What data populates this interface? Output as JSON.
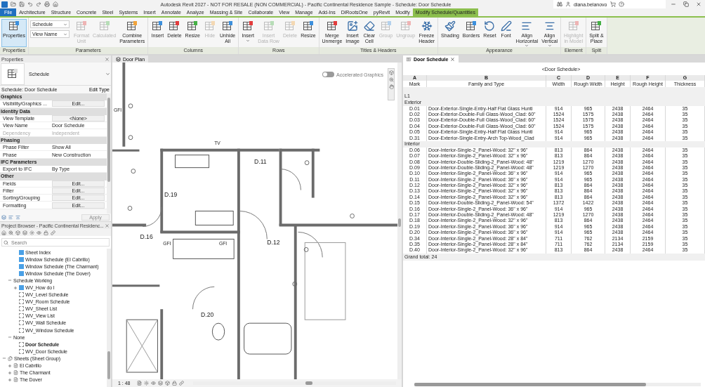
{
  "title_bar": {
    "title": "Autodesk Revit 2027 - NOT FOR RESALE (NON COMMERCIAL) - Pacific Continental Residence Sample - Schedule: Door Schedule",
    "user": "diana.belanovo"
  },
  "menu_tabs": [
    {
      "label": "File",
      "kind": "file",
      "selected": false
    },
    {
      "label": "Architecture",
      "kind": "tab",
      "selected": false
    },
    {
      "label": "Structure",
      "kind": "tab",
      "selected": false
    },
    {
      "label": "Concrete",
      "kind": "tab",
      "selected": false
    },
    {
      "label": "Steel",
      "kind": "tab",
      "selected": false
    },
    {
      "label": "Systems",
      "kind": "tab",
      "selected": false
    },
    {
      "label": "Insert",
      "kind": "tab",
      "selected": false
    },
    {
      "label": "Annotate",
      "kind": "tab",
      "selected": false
    },
    {
      "label": "Analyze",
      "kind": "tab",
      "selected": false
    },
    {
      "label": "Massing & Site",
      "kind": "tab",
      "selected": false
    },
    {
      "label": "Collaborate",
      "kind": "tab",
      "selected": false
    },
    {
      "label": "View",
      "kind": "tab",
      "selected": false
    },
    {
      "label": "Manage",
      "kind": "tab",
      "selected": false
    },
    {
      "label": "Add-Ins",
      "kind": "tab",
      "selected": false
    },
    {
      "label": "DiRootsOne",
      "kind": "tab",
      "selected": false
    },
    {
      "label": "pyRevit",
      "kind": "tab",
      "selected": false
    },
    {
      "label": "Modify",
      "kind": "tab",
      "selected": false
    },
    {
      "label": "Modify Schedule/Quantities",
      "kind": "context",
      "selected": true
    }
  ],
  "ribbon": [
    {
      "title": "Properties",
      "buttons": [
        {
          "label": "Properties",
          "disabled": false,
          "pressed": true
        }
      ]
    },
    {
      "title": "Parameters",
      "selects": [
        "Schedule",
        "View Name"
      ],
      "buttons": [
        {
          "label": "Format\nUnit",
          "disabled": true
        },
        {
          "label": "Calculated",
          "disabled": true
        },
        {
          "label": "Combine\nParameters",
          "disabled": false
        }
      ]
    },
    {
      "title": "Columns",
      "buttons": [
        {
          "label": "Insert",
          "disabled": false
        },
        {
          "label": "Delete",
          "disabled": false
        },
        {
          "label": "Resize",
          "disabled": false
        },
        {
          "label": "Hide",
          "disabled": true
        },
        {
          "label": "Unhide\nAll",
          "disabled": false
        }
      ]
    },
    {
      "title": "Rows",
      "buttons": [
        {
          "label": "Insert",
          "disabled": false,
          "menu": true
        },
        {
          "label": "Insert\nData Row",
          "disabled": true
        },
        {
          "label": "Delete",
          "disabled": true
        },
        {
          "label": "Resize",
          "disabled": false
        }
      ]
    },
    {
      "title": "Titles & Headers",
      "buttons": [
        {
          "label": "Merge\nUnmerge",
          "disabled": false
        },
        {
          "label": "Insert\nImage",
          "disabled": false
        },
        {
          "label": "Clear\nCell",
          "disabled": false
        },
        {
          "label": "Group",
          "disabled": true
        },
        {
          "label": "Ungroup",
          "disabled": true
        },
        {
          "label": "Freeze\nHeader",
          "disabled": false
        }
      ]
    },
    {
      "title": "Appearance",
      "buttons": [
        {
          "label": "Shading",
          "disabled": false
        },
        {
          "label": "Borders",
          "disabled": false
        },
        {
          "label": "Reset",
          "disabled": false
        },
        {
          "label": "Font",
          "disabled": false
        },
        {
          "label": "Align\nHorizontal",
          "disabled": false,
          "menu": true
        },
        {
          "label": "Align\nVertical",
          "disabled": false,
          "menu": true
        }
      ]
    },
    {
      "title": "Element",
      "buttons": [
        {
          "label": "Highlight\nin Model",
          "disabled": true
        }
      ]
    },
    {
      "title": "Split",
      "buttons": [
        {
          "label": "Split &\nPlace",
          "disabled": false
        }
      ]
    }
  ],
  "properties": {
    "title": "Properties",
    "type_name": "Schedule",
    "selector": "Schedule: Door Schedule",
    "edit_type": "Edit Type",
    "sections": [
      {
        "title": "Graphics",
        "rows": [
          {
            "label": "Visibility/Graphics ...",
            "value": "Edit...",
            "kind": "button",
            "disabled": false
          }
        ]
      },
      {
        "title": "Identity Data",
        "rows": [
          {
            "label": "View Template",
            "value": "<None>",
            "kind": "button",
            "disabled": false
          },
          {
            "label": "View Name",
            "value": "Door Schedule",
            "kind": "text",
            "disabled": false
          },
          {
            "label": "Dependency",
            "value": "Independent",
            "kind": "text",
            "disabled": true
          }
        ]
      },
      {
        "title": "Phasing",
        "rows": [
          {
            "label": "Phase Filter",
            "value": "Show All",
            "kind": "text",
            "disabled": false
          },
          {
            "label": "Phase",
            "value": "New Construction",
            "kind": "text",
            "disabled": false
          }
        ]
      },
      {
        "title": "IFC Parameters",
        "rows": [
          {
            "label": "Export to IFC",
            "value": "By Type",
            "kind": "text",
            "disabled": false
          }
        ]
      },
      {
        "title": "Other",
        "rows": [
          {
            "label": "Fields",
            "value": "Edit...",
            "kind": "button",
            "disabled": false
          },
          {
            "label": "Filter",
            "value": "Edit...",
            "kind": "button",
            "disabled": false
          },
          {
            "label": "Sorting/Grouping",
            "value": "Edit...",
            "kind": "button",
            "disabled": false
          },
          {
            "label": "Formatting",
            "value": "Edit...",
            "kind": "button",
            "disabled": false
          }
        ]
      }
    ],
    "apply": "Apply"
  },
  "project_browser": {
    "title": "Project Browser - Pacific Continental Residenc...",
    "search": {
      "placeholder": "Search"
    },
    "tree": [
      {
        "children": [
          {
            "children": [
              {
                "label": "Sheet Index",
                "kind": "schedule",
                "on_sheet": true,
                "selected": false
              },
              {
                "label": "Window Schedule (El Cabrillo)",
                "kind": "schedule",
                "on_sheet": true,
                "selected": false
              },
              {
                "label": "Window Schedule (The Charmant)",
                "kind": "schedule",
                "on_sheet": true,
                "selected": false
              },
              {
                "label": "Window Schedule (The Dover)",
                "kind": "schedule",
                "on_sheet": true,
                "selected": false
              }
            ]
          },
          {
            "label": "Schedule Working",
            "kind": "folder",
            "expanded": true,
            "children": [
              {
                "label": "WV_How do I",
                "kind": "schedule",
                "on_sheet": true,
                "expanded": false,
                "selected": false
              },
              {
                "label": "WV_Level Schedule",
                "kind": "schedule",
                "on_sheet": false,
                "selected": false
              },
              {
                "label": "WV_Room Schedule",
                "kind": "schedule",
                "on_sheet": false,
                "selected": false
              },
              {
                "label": "WV_Sheet List",
                "kind": "schedule",
                "on_sheet": false,
                "selected": false
              },
              {
                "label": "WV_View List",
                "kind": "schedule",
                "on_sheet": false,
                "selected": false
              },
              {
                "label": "WV_Wall Schedule",
                "kind": "schedule",
                "on_sheet": false,
                "selected": false
              },
              {
                "label": "WV_Window Schedule",
                "kind": "schedule",
                "on_sheet": false,
                "selected": false
              }
            ]
          },
          {
            "label": "None",
            "kind": "folder",
            "expanded": true,
            "children": [
              {
                "label": "Door Schedule",
                "kind": "schedule",
                "on_sheet": false,
                "selected": true
              },
              {
                "label": "WV_Door Schedule",
                "kind": "schedule",
                "on_sheet": false,
                "selected": false
              }
            ]
          }
        ]
      },
      {
        "label": "Sheets (Sheet Group)",
        "kind": "sheet_group",
        "expanded": true,
        "children": [
          {
            "label": "El Cabrillo",
            "kind": "sheet",
            "expanded": false
          },
          {
            "label": "The Charmant",
            "kind": "sheet",
            "expanded": false
          },
          {
            "label": "The Dover",
            "kind": "sheet",
            "expanded": false
          }
        ]
      }
    ]
  },
  "plan_view": {
    "tab": "Door Plan",
    "accelerated_graphics": {
      "label": "Accelerated Graphics",
      "on": false
    },
    "door_tags": [
      "D.11",
      "D.19",
      "D.16",
      "D.12",
      "D.20"
    ],
    "labels": [
      "TV",
      "GFI",
      "GFI",
      "GFI"
    ],
    "scale": "1 : 48"
  },
  "schedule": {
    "tab": "Door Schedule",
    "title": "<Door Schedule>",
    "column_letters": [
      "A",
      "B",
      "C",
      "D",
      "E",
      "F",
      "G"
    ],
    "columns": [
      "Mark",
      "Family and Type",
      "Width",
      "Rough Width",
      "Height",
      "Rough Height",
      "Thickness"
    ],
    "level": "L1",
    "groups": [
      {
        "name": "Exterior",
        "rows": [
          [
            "D.01",
            "Door-Exterior-Single-Entry-Half Flat Glass Hunti",
            "914",
            "965",
            "2438",
            "2464",
            "35"
          ],
          [
            "D.02",
            "Door-Exterior-Double-Full Glass-Wood_Clad: 60\"",
            "1524",
            "1575",
            "2438",
            "2464",
            "35"
          ],
          [
            "D.03",
            "Door-Exterior-Double-Full Glass-Wood_Clad: 60\"",
            "1524",
            "1575",
            "2438",
            "2464",
            "35"
          ],
          [
            "D.04",
            "Door-Exterior-Double-Full Glass-Wood_Clad: 60\"",
            "1524",
            "1575",
            "2438",
            "2464",
            "35"
          ],
          [
            "D.05",
            "Door-Exterior-Single-Entry-Half Flat Glass Hunti",
            "914",
            "965",
            "2438",
            "2464",
            "35"
          ],
          [
            "D.31",
            "Door-Exterior-Single-Entry-Arch Top-Wood_Clad",
            "914",
            "965",
            "2438",
            "2464",
            "35"
          ]
        ]
      },
      {
        "name": "Interior",
        "rows": [
          [
            "D.06",
            "Door-Interior-Single-2_Panel-Wood: 32\" x 96\"",
            "813",
            "864",
            "2438",
            "2464",
            "35"
          ],
          [
            "D.07",
            "Door-Interior-Single-2_Panel-Wood: 32\" x 96\"",
            "813",
            "864",
            "2438",
            "2464",
            "35"
          ],
          [
            "D.08",
            "Door-Interior-Double-Sliding-2_Panel-Wood: 48\"",
            "1219",
            "1270",
            "2438",
            "2464",
            "35"
          ],
          [
            "D.09",
            "Door-Interior-Double-Sliding-2_Panel-Wood: 48\"",
            "1219",
            "1270",
            "2438",
            "2464",
            "35"
          ],
          [
            "D.10",
            "Door-Interior-Single-2_Panel-Wood: 36\" x 96\"",
            "914",
            "965",
            "2438",
            "2464",
            "35"
          ],
          [
            "D.11",
            "Door-Interior-Single-2_Panel-Wood: 36\" x 96\"",
            "914",
            "965",
            "2438",
            "2464",
            "35"
          ],
          [
            "D.12",
            "Door-Interior-Single-2_Panel-Wood: 32\" x 96\"",
            "813",
            "864",
            "2438",
            "2464",
            "35"
          ],
          [
            "D.13",
            "Door-Interior-Single-2_Panel-Wood: 32\" x 96\"",
            "813",
            "864",
            "2438",
            "2464",
            "35"
          ],
          [
            "D.14",
            "Door-Interior-Single-2_Panel-Wood: 32\" x 96\"",
            "813",
            "864",
            "2438",
            "2464",
            "35"
          ],
          [
            "D.15",
            "Door-Interior-Double-Sliding-2_Panel-Wood: 54\"",
            "1372",
            "1422",
            "2438",
            "2464",
            "35"
          ],
          [
            "D.16",
            "Door-Interior-Single-2_Panel-Wood: 36\" x 96\"",
            "914",
            "965",
            "2438",
            "2464",
            "35"
          ],
          [
            "D.17",
            "Door-Interior-Double-Sliding-2_Panel-Wood: 48\"",
            "1219",
            "1270",
            "2438",
            "2464",
            "35"
          ],
          [
            "D.18",
            "Door-Interior-Single-2_Panel-Wood: 32\" x 96\"",
            "813",
            "864",
            "2438",
            "2464",
            "35"
          ],
          [
            "D.19",
            "Door-Interior-Single-2_Panel-Wood: 36\" x 96\"",
            "914",
            "965",
            "2438",
            "2464",
            "35"
          ],
          [
            "D.20",
            "Door-Interior-Single-2_Panel-Wood: 36\" x 96\"",
            "914",
            "965",
            "2438",
            "2464",
            "35"
          ],
          [
            "D.34",
            "Door-Interior-Single-2_Panel-Wood: 28\" x 84\"",
            "711",
            "762",
            "2134",
            "2159",
            "35"
          ],
          [
            "D.35",
            "Door-Interior-Single-2_Panel-Wood: 28\" x 84\"",
            "711",
            "762",
            "2134",
            "2159",
            "35"
          ],
          [
            "D.40",
            "Door-Interior-Single-2_Panel-Wood: 32\" x 96\"",
            "813",
            "864",
            "2438",
            "2464",
            "35"
          ]
        ]
      }
    ],
    "grand_total": "Grand total: 24"
  }
}
